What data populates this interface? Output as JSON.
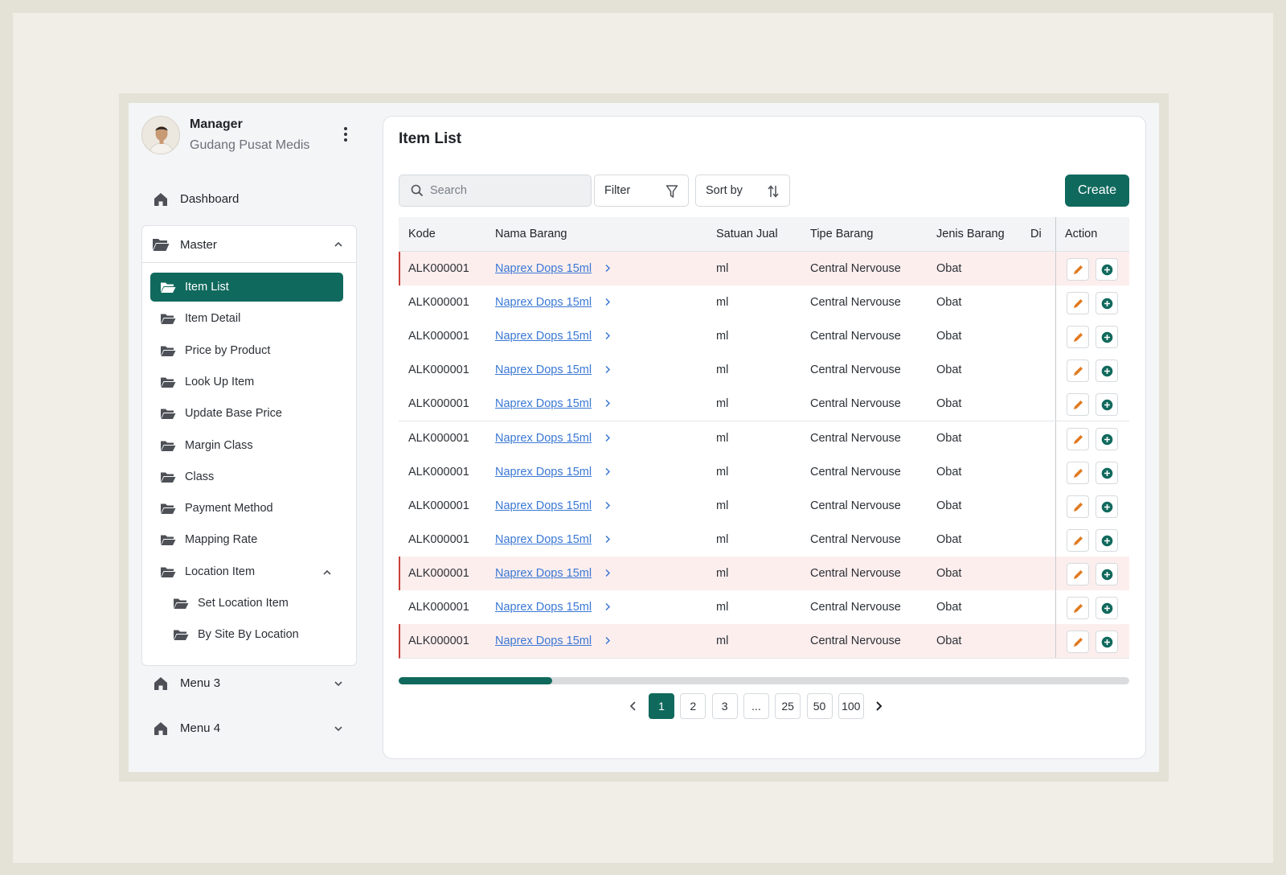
{
  "profile": {
    "name": "Manager",
    "org": "Gudang Pusat Medis"
  },
  "sidebar": {
    "dashboard": "Dashboard",
    "master": {
      "label": "Master",
      "items": [
        {
          "label": "Item List"
        },
        {
          "label": "Item Detail"
        },
        {
          "label": "Price by Product"
        },
        {
          "label": "Look Up Item"
        },
        {
          "label": "Update Base Price"
        },
        {
          "label": "Margin Class"
        },
        {
          "label": "Class"
        },
        {
          "label": "Payment Method"
        },
        {
          "label": "Mapping Rate"
        },
        {
          "label": "Location Item"
        }
      ],
      "location_children": [
        {
          "label": "Set Location Item"
        },
        {
          "label": "By Site By Location"
        }
      ]
    },
    "menu3": "Menu 3",
    "menu4": "Menu 4"
  },
  "main": {
    "title": "Item List",
    "search_placeholder": "Search",
    "filter_label": "Filter",
    "sort_label": "Sort by",
    "create_label": "Create"
  },
  "table": {
    "columns": [
      "Kode",
      "Nama Barang",
      "Satuan Jual",
      "Tipe Barang",
      "Jenis Barang",
      "Di",
      "Action"
    ],
    "rows": [
      {
        "kode": "ALK000001",
        "nama": "Naprex Dops 15ml",
        "satuan": "ml",
        "tipe": "Central Nervouse",
        "jenis": "Obat",
        "flag": true
      },
      {
        "kode": "ALK000001",
        "nama": "Naprex Dops 15ml",
        "satuan": "ml",
        "tipe": "Central Nervouse",
        "jenis": "Obat",
        "flag": false
      },
      {
        "kode": "ALK000001",
        "nama": "Naprex Dops 15ml",
        "satuan": "ml",
        "tipe": "Central Nervouse",
        "jenis": "Obat",
        "flag": false
      },
      {
        "kode": "ALK000001",
        "nama": "Naprex Dops 15ml",
        "satuan": "ml",
        "tipe": "Central Nervouse",
        "jenis": "Obat",
        "flag": false
      },
      {
        "kode": "ALK000001",
        "nama": "Naprex Dops 15ml",
        "satuan": "ml",
        "tipe": "Central Nervouse",
        "jenis": "Obat",
        "flag": false
      },
      {
        "kode": "ALK000001",
        "nama": "Naprex Dops 15ml",
        "satuan": "ml",
        "tipe": "Central Nervouse",
        "jenis": "Obat",
        "flag": false
      },
      {
        "kode": "ALK000001",
        "nama": "Naprex Dops 15ml",
        "satuan": "ml",
        "tipe": "Central Nervouse",
        "jenis": "Obat",
        "flag": false
      },
      {
        "kode": "ALK000001",
        "nama": "Naprex Dops 15ml",
        "satuan": "ml",
        "tipe": "Central Nervouse",
        "jenis": "Obat",
        "flag": false
      },
      {
        "kode": "ALK000001",
        "nama": "Naprex Dops 15ml",
        "satuan": "ml",
        "tipe": "Central Nervouse",
        "jenis": "Obat",
        "flag": false
      },
      {
        "kode": "ALK000001",
        "nama": "Naprex Dops 15ml",
        "satuan": "ml",
        "tipe": "Central Nervouse",
        "jenis": "Obat",
        "flag": true
      },
      {
        "kode": "ALK000001",
        "nama": "Naprex Dops 15ml",
        "satuan": "ml",
        "tipe": "Central Nervouse",
        "jenis": "Obat",
        "flag": false
      },
      {
        "kode": "ALK000001",
        "nama": "Naprex Dops 15ml",
        "satuan": "ml",
        "tipe": "Central Nervouse",
        "jenis": "Obat",
        "flag": true
      }
    ]
  },
  "scroll": {
    "position_fraction": 0.21
  },
  "pagination": {
    "pages": [
      "1",
      "2",
      "3",
      "...",
      "25",
      "50",
      "100"
    ],
    "active": "1"
  },
  "colors": {
    "primary": "#10695d",
    "link": "#3a78d4",
    "warn_row": "#fdeeee",
    "warn_border": "#c9403a",
    "edit_icon": "#e07a1f"
  },
  "icons": {
    "home": "home-icon",
    "folder": "folder-icon",
    "search": "search-icon",
    "filter": "filter-icon",
    "sort": "sort-icon",
    "edit": "pencil-icon",
    "add": "plus-circle-icon"
  }
}
